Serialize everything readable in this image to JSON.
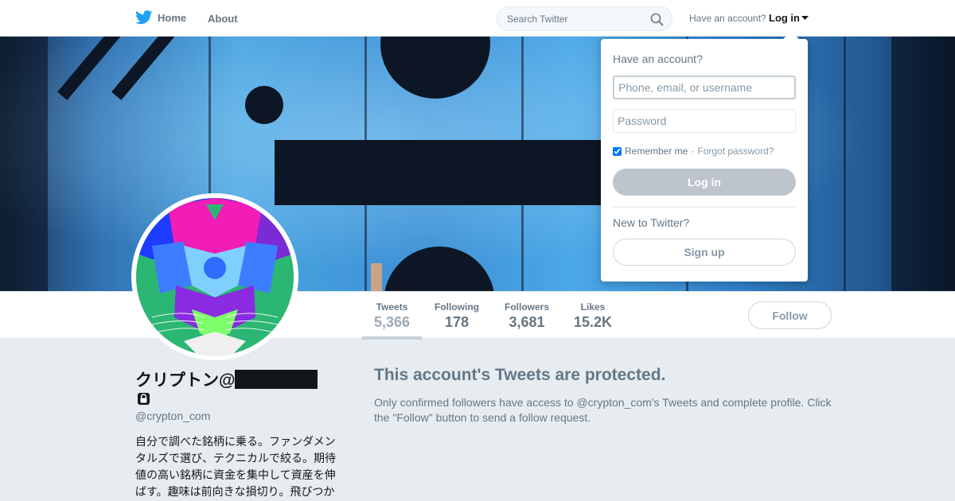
{
  "nav": {
    "home_label": "Home",
    "about_label": "About",
    "search_placeholder": "Search Twitter",
    "have_account": "Have an account?",
    "login_label": "Log in",
    "brand_color": "#1da1f2"
  },
  "profile": {
    "name": "クリプトン@",
    "handle": "@crypton_com",
    "bio": "自分で調べた銘柄に乗る。ファンダメンタルズで選び、テクニカルで絞る。期待値の高い銘柄に資金を集中して資産を伸ばす。趣味は前向きな損切り。飛びつかず"
  },
  "stats": [
    {
      "label": "Tweets",
      "value": "5,366"
    },
    {
      "label": "Following",
      "value": "178"
    },
    {
      "label": "Followers",
      "value": "3,681"
    },
    {
      "label": "Likes",
      "value": "15.2K"
    }
  ],
  "follow_label": "Follow",
  "protected": {
    "title": "This account's Tweets are protected.",
    "body": "Only confirmed followers have access to @crypton_com's Tweets and complete profile. Click the \"Follow\" button to send a follow request."
  },
  "login_dropdown": {
    "title": "Have an account?",
    "username_placeholder": "Phone, email, or username",
    "password_placeholder": "Password",
    "remember_label": "Remember me",
    "separator": "·",
    "forgot_label": "Forgot password?",
    "login_button": "Log in",
    "new_label": "New to Twitter?",
    "signup_button": "Sign up"
  }
}
